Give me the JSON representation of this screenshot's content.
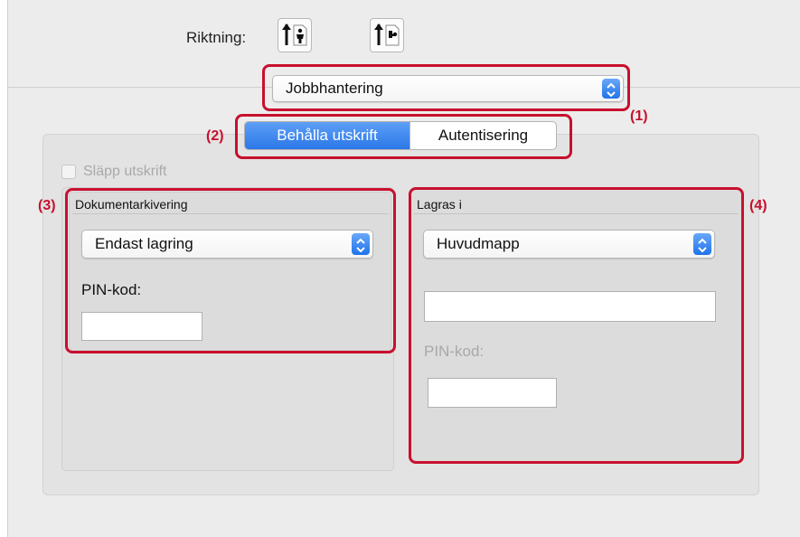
{
  "orientation": {
    "label": "Riktning:",
    "options": [
      {
        "icon": "portrait-orientation-icon",
        "selected": true
      },
      {
        "icon": "landscape-orientation-icon",
        "selected": false
      }
    ]
  },
  "menu_select": {
    "value": "Jobbhantering"
  },
  "tabs": {
    "items": [
      "Behålla utskrift",
      "Autentisering"
    ],
    "selected": "Behålla utskrift"
  },
  "release_checkbox": {
    "label": "Släpp utskrift",
    "checked": false,
    "enabled": false
  },
  "document_filing": {
    "title": "Dokumentarkivering",
    "select_value": "Endast lagring",
    "pin_label": "PIN-kod:",
    "pin_value": ""
  },
  "store_in": {
    "title": "Lagras i",
    "select_value": "Huvudmapp",
    "folder_value": "",
    "pin_label": "PIN-kod:",
    "pin_value": ""
  },
  "callouts": [
    "(1)",
    "(2)",
    "(3)",
    "(4)"
  ],
  "colors": {
    "callout_red": "#c8102e",
    "accent_blue": "#2a77e8"
  }
}
